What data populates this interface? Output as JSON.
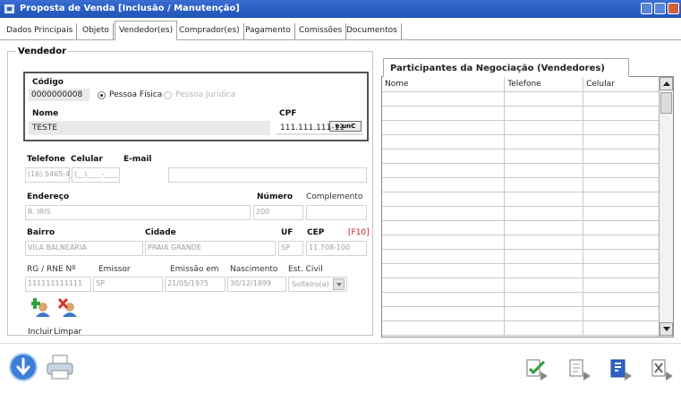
{
  "window": {
    "title": "Proposta de Venda [Inclusão / Manutenção]"
  },
  "tabs": [
    {
      "label": "Dados Principais"
    },
    {
      "label": "Objeto"
    },
    {
      "label": "Vendedor(es)"
    },
    {
      "label": "Comprador(es)"
    },
    {
      "label": "Pagamento"
    },
    {
      "label": "Comissões"
    },
    {
      "label": "Documentos"
    }
  ],
  "vendedor": {
    "legend": "Vendedor",
    "codigo_label": "Código",
    "codigo_value": "0000000008",
    "pf_label": "Pessoa Física",
    "pj_label": "Pessoa Jurídica",
    "nome_label": "Nome",
    "nome_value": "TESTE",
    "cpf_label": "CPF",
    "cpf_button": "e.unC",
    "cpf_value": "111.111.111-11",
    "telefone_label": "Telefone",
    "telefone_value": "(16) 5465-4___",
    "celular_label": "Celular",
    "celular_value": "(__)____-____",
    "email_label": "E-mail",
    "email_value": "",
    "endereco_label": "Endereço",
    "endereco_value": "R. IRIS",
    "numero_label": "Número",
    "numero_value": "200",
    "complemento_label": "Complemento",
    "complemento_value": "",
    "bairro_label": "Bairro",
    "bairro_value": "VILA BALNEARIA",
    "cidade_label": "Cidade",
    "cidade_value": "PRAIA GRANDE",
    "uf_label": "UF",
    "uf_value": "SP",
    "cep_label": "CEP",
    "cep_hint": "[F10]",
    "cep_value": "11.708-100",
    "rg_label": "RG / RNE Nº",
    "rg_value": "111111111111",
    "emissor_label": "Emissor",
    "emissor_value": "SP",
    "emissao_label": "Emissão em",
    "emissao_value": "21/05/1975",
    "nascimento_label": "Nascimento",
    "nascimento_value": "30/12/1899",
    "estcivil_label": "Est. Civil",
    "estcivil_value": "Solteiro(a)"
  },
  "actions": {
    "incluir": "Incluir",
    "limpar": "Limpar"
  },
  "participantes": {
    "title": "Participantes da Negociação (Vendedores)",
    "columns": [
      "Nome",
      "Telefone",
      "Celular"
    ]
  },
  "icons": {
    "help": "info-arrow-icon",
    "print": "printer-icon",
    "bottom_right": [
      "check-doc-icon",
      "edit-doc-icon",
      "report-icon",
      "cancel-doc-icon"
    ]
  },
  "colors": {
    "titlebar": "#2d5fc4",
    "red_hint": "#cc2222"
  }
}
